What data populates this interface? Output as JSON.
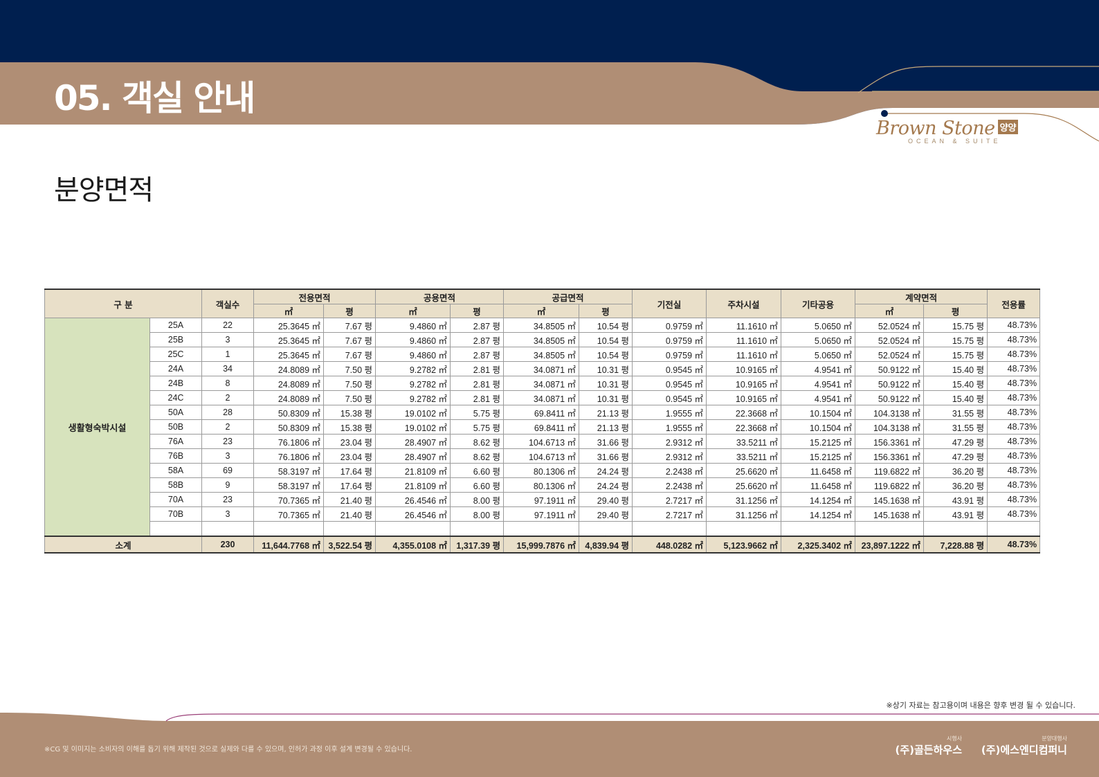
{
  "header": {
    "section_title": "05. 객실 안내",
    "brand_name": "Brown Stone",
    "brand_badge": "양양",
    "brand_sub": "OCEAN & SUITE",
    "colors": {
      "navy": "#001f4f",
      "tan": "#b08e75",
      "gold": "#a57a4f"
    }
  },
  "page_subtitle": "분양면적",
  "table": {
    "headers": {
      "category": "구  분",
      "rooms": "객실수",
      "exclusive": "전용면적",
      "common": "공용면적",
      "supply": "공급면적",
      "electrical": "기전실",
      "parking": "주차시설",
      "other_common": "기타공용",
      "contract": "계약면적",
      "ratio": "전용률",
      "unit_m2": "㎡",
      "unit_py": "평"
    },
    "category_name": "생활형숙박시설",
    "rows": [
      {
        "type": "25A",
        "rooms": "22",
        "ex_m2": "25.3645 ㎡",
        "ex_py": "7.67 평",
        "co_m2": "9.4860 ㎡",
        "co_py": "2.87 평",
        "su_m2": "34.8505 ㎡",
        "su_py": "10.54 평",
        "elec": "0.9759 ㎡",
        "park": "11.1610 ㎡",
        "other": "5.0650 ㎡",
        "ct_m2": "52.0524 ㎡",
        "ct_py": "15.75 평",
        "ratio": "48.73%"
      },
      {
        "type": "25B",
        "rooms": "3",
        "ex_m2": "25.3645 ㎡",
        "ex_py": "7.67 평",
        "co_m2": "9.4860 ㎡",
        "co_py": "2.87 평",
        "su_m2": "34.8505 ㎡",
        "su_py": "10.54 평",
        "elec": "0.9759 ㎡",
        "park": "11.1610 ㎡",
        "other": "5.0650 ㎡",
        "ct_m2": "52.0524 ㎡",
        "ct_py": "15.75 평",
        "ratio": "48.73%"
      },
      {
        "type": "25C",
        "rooms": "1",
        "ex_m2": "25.3645 ㎡",
        "ex_py": "7.67 평",
        "co_m2": "9.4860 ㎡",
        "co_py": "2.87 평",
        "su_m2": "34.8505 ㎡",
        "su_py": "10.54 평",
        "elec": "0.9759 ㎡",
        "park": "11.1610 ㎡",
        "other": "5.0650 ㎡",
        "ct_m2": "52.0524 ㎡",
        "ct_py": "15.75 평",
        "ratio": "48.73%"
      },
      {
        "type": "24A",
        "rooms": "34",
        "ex_m2": "24.8089 ㎡",
        "ex_py": "7.50 평",
        "co_m2": "9.2782 ㎡",
        "co_py": "2.81 평",
        "su_m2": "34.0871 ㎡",
        "su_py": "10.31 평",
        "elec": "0.9545 ㎡",
        "park": "10.9165 ㎡",
        "other": "4.9541 ㎡",
        "ct_m2": "50.9122 ㎡",
        "ct_py": "15.40 평",
        "ratio": "48.73%"
      },
      {
        "type": "24B",
        "rooms": "8",
        "ex_m2": "24.8089 ㎡",
        "ex_py": "7.50 평",
        "co_m2": "9.2782 ㎡",
        "co_py": "2.81 평",
        "su_m2": "34.0871 ㎡",
        "su_py": "10.31 평",
        "elec": "0.9545 ㎡",
        "park": "10.9165 ㎡",
        "other": "4.9541 ㎡",
        "ct_m2": "50.9122 ㎡",
        "ct_py": "15.40 평",
        "ratio": "48.73%"
      },
      {
        "type": "24C",
        "rooms": "2",
        "ex_m2": "24.8089 ㎡",
        "ex_py": "7.50 평",
        "co_m2": "9.2782 ㎡",
        "co_py": "2.81 평",
        "su_m2": "34.0871 ㎡",
        "su_py": "10.31 평",
        "elec": "0.9545 ㎡",
        "park": "10.9165 ㎡",
        "other": "4.9541 ㎡",
        "ct_m2": "50.9122 ㎡",
        "ct_py": "15.40 평",
        "ratio": "48.73%"
      },
      {
        "type": "50A",
        "rooms": "28",
        "ex_m2": "50.8309 ㎡",
        "ex_py": "15.38 평",
        "co_m2": "19.0102 ㎡",
        "co_py": "5.75 평",
        "su_m2": "69.8411 ㎡",
        "su_py": "21.13 평",
        "elec": "1.9555 ㎡",
        "park": "22.3668 ㎡",
        "other": "10.1504 ㎡",
        "ct_m2": "104.3138 ㎡",
        "ct_py": "31.55 평",
        "ratio": "48.73%"
      },
      {
        "type": "50B",
        "rooms": "2",
        "ex_m2": "50.8309 ㎡",
        "ex_py": "15.38 평",
        "co_m2": "19.0102 ㎡",
        "co_py": "5.75 평",
        "su_m2": "69.8411 ㎡",
        "su_py": "21.13 평",
        "elec": "1.9555 ㎡",
        "park": "22.3668 ㎡",
        "other": "10.1504 ㎡",
        "ct_m2": "104.3138 ㎡",
        "ct_py": "31.55 평",
        "ratio": "48.73%"
      },
      {
        "type": "76A",
        "rooms": "23",
        "ex_m2": "76.1806 ㎡",
        "ex_py": "23.04 평",
        "co_m2": "28.4907 ㎡",
        "co_py": "8.62 평",
        "su_m2": "104.6713 ㎡",
        "su_py": "31.66 평",
        "elec": "2.9312 ㎡",
        "park": "33.5211 ㎡",
        "other": "15.2125 ㎡",
        "ct_m2": "156.3361 ㎡",
        "ct_py": "47.29 평",
        "ratio": "48.73%"
      },
      {
        "type": "76B",
        "rooms": "3",
        "ex_m2": "76.1806 ㎡",
        "ex_py": "23.04 평",
        "co_m2": "28.4907 ㎡",
        "co_py": "8.62 평",
        "su_m2": "104.6713 ㎡",
        "su_py": "31.66 평",
        "elec": "2.9312 ㎡",
        "park": "33.5211 ㎡",
        "other": "15.2125 ㎡",
        "ct_m2": "156.3361 ㎡",
        "ct_py": "47.29 평",
        "ratio": "48.73%"
      },
      {
        "type": "58A",
        "rooms": "69",
        "ex_m2": "58.3197 ㎡",
        "ex_py": "17.64 평",
        "co_m2": "21.8109 ㎡",
        "co_py": "6.60 평",
        "su_m2": "80.1306 ㎡",
        "su_py": "24.24 평",
        "elec": "2.2438 ㎡",
        "park": "25.6620 ㎡",
        "other": "11.6458 ㎡",
        "ct_m2": "119.6822 ㎡",
        "ct_py": "36.20 평",
        "ratio": "48.73%"
      },
      {
        "type": "58B",
        "rooms": "9",
        "ex_m2": "58.3197 ㎡",
        "ex_py": "17.64 평",
        "co_m2": "21.8109 ㎡",
        "co_py": "6.60 평",
        "su_m2": "80.1306 ㎡",
        "su_py": "24.24 평",
        "elec": "2.2438 ㎡",
        "park": "25.6620 ㎡",
        "other": "11.6458 ㎡",
        "ct_m2": "119.6822 ㎡",
        "ct_py": "36.20 평",
        "ratio": "48.73%"
      },
      {
        "type": "70A",
        "rooms": "23",
        "ex_m2": "70.7365 ㎡",
        "ex_py": "21.40 평",
        "co_m2": "26.4546 ㎡",
        "co_py": "8.00 평",
        "su_m2": "97.1911 ㎡",
        "su_py": "29.40 평",
        "elec": "2.7217 ㎡",
        "park": "31.1256 ㎡",
        "other": "14.1254 ㎡",
        "ct_m2": "145.1638 ㎡",
        "ct_py": "43.91 평",
        "ratio": "48.73%"
      },
      {
        "type": "70B",
        "rooms": "3",
        "ex_m2": "70.7365 ㎡",
        "ex_py": "21.40 평",
        "co_m2": "26.4546 ㎡",
        "co_py": "8.00 평",
        "su_m2": "97.1911 ㎡",
        "su_py": "29.40 평",
        "elec": "2.7217 ㎡",
        "park": "31.1256 ㎡",
        "other": "14.1254 ㎡",
        "ct_m2": "145.1638 ㎡",
        "ct_py": "43.91 평",
        "ratio": "48.73%"
      }
    ],
    "total": {
      "label": "소계",
      "rooms": "230",
      "ex_m2": "11,644.7768 ㎡",
      "ex_py": "3,522.54 평",
      "co_m2": "4,355.0108 ㎡",
      "co_py": "1,317.39 평",
      "su_m2": "15,999.7876 ㎡",
      "su_py": "4,839.94 평",
      "elec": "448.0282 ㎡",
      "park": "5,123.9662 ㎡",
      "other": "2,325.3402 ㎡",
      "ct_m2": "23,897.1222 ㎡",
      "ct_py": "7,228.88 평",
      "ratio": "48.73%"
    },
    "category_color": "#d7e3bd",
    "header_color": "#e9dfc9"
  },
  "footer": {
    "disclaimer": "※상기 자료는 참고용이며 내용은 향후 변경 될 수 있습니다.",
    "note": "※CG 및 이미지는 소비자의 이해를 돕기 위해 제작된 것으로 실제와 다를 수 있으며, 인허가 과정 이후 설계 변경될 수 있습니다.",
    "builder_role": "시행사",
    "builder_name": "(주)골든하우스",
    "agent_role": "분양대행사",
    "agent_name": "(주)에스엔디컴퍼니"
  }
}
